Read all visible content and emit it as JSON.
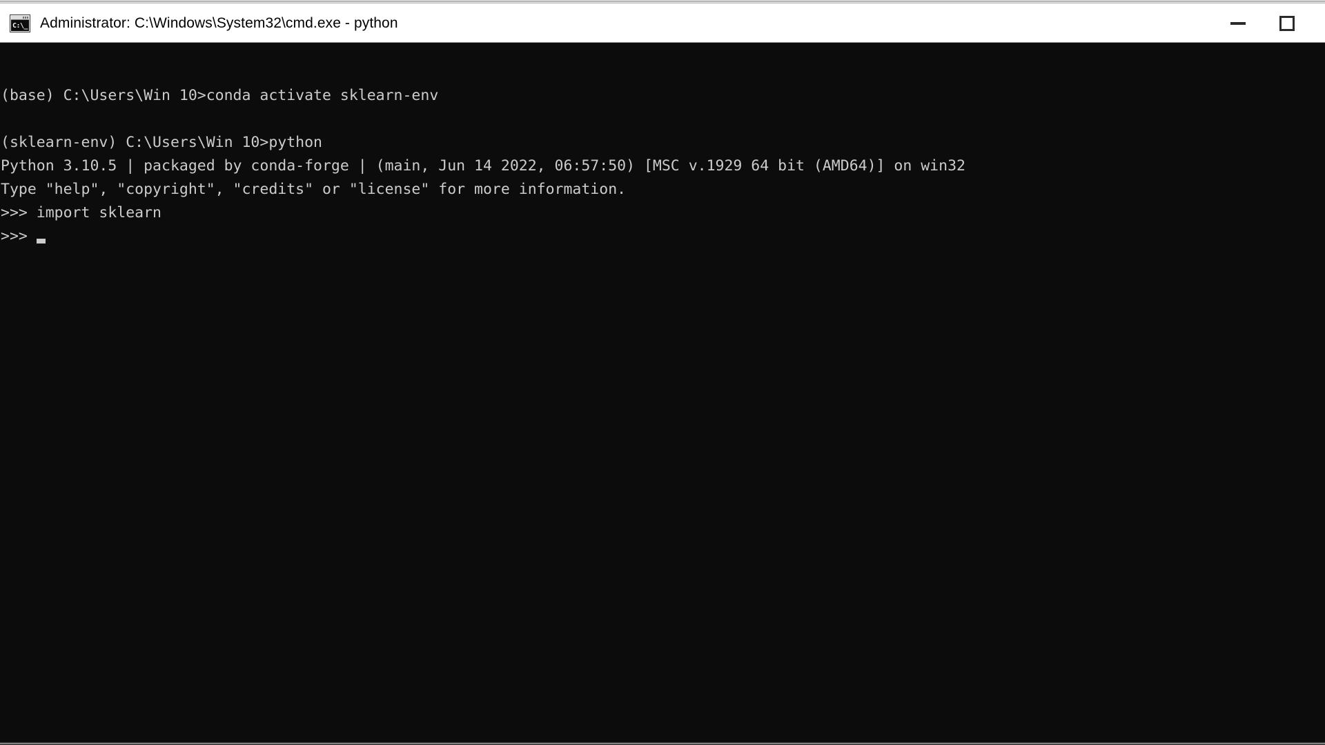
{
  "window": {
    "title": "Administrator: C:\\Windows\\System32\\cmd.exe - python",
    "icon_name": "cmd-console-icon",
    "icon_glyph": "C:\\_",
    "controls": {
      "minimize_label": "—",
      "maximize_label": "□"
    },
    "colors": {
      "titlebar_background": "#ffffff",
      "titlebar_text": "#000000",
      "terminal_background": "#0c0c0c",
      "terminal_text": "#cccccc",
      "cursor": "#cccccc",
      "border": "#9a9a9a"
    }
  },
  "terminal": {
    "prompt_base": "(base) C:\\Users\\Win 10>",
    "prompt_env": "(sklearn-env) C:\\Users\\Win 10>",
    "python_prompt": ">>> ",
    "cursor_visible": true,
    "lines": [
      {
        "id": "blank-1",
        "text": ""
      },
      {
        "id": "cmd-conda-activate",
        "text": "(base) C:\\Users\\Win 10>conda activate sklearn-env"
      },
      {
        "id": "blank-2",
        "text": ""
      },
      {
        "id": "cmd-python",
        "text": "(sklearn-env) C:\\Users\\Win 10>python"
      },
      {
        "id": "python-version-banner",
        "text": "Python 3.10.5 | packaged by conda-forge | (main, Jun 14 2022, 06:57:50) [MSC v.1929 64 bit (AMD64)] on win32"
      },
      {
        "id": "python-help-banner",
        "text": "Type \"help\", \"copyright\", \"credits\" or \"license\" for more information."
      },
      {
        "id": "cmd-import-sklearn",
        "text": ">>> import sklearn"
      }
    ]
  }
}
